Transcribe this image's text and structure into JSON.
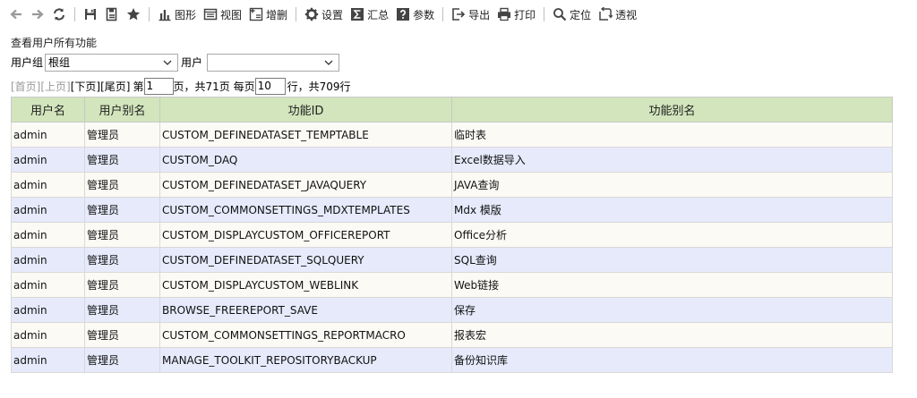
{
  "toolbar": {
    "buttons": [
      {
        "name": "back-icon",
        "label": ""
      },
      {
        "name": "forward-icon",
        "label": ""
      },
      {
        "name": "refresh-icon",
        "label": ""
      },
      {
        "name": "save-icon",
        "label": ""
      },
      {
        "name": "save-as-icon",
        "label": ""
      },
      {
        "name": "favorite-icon",
        "label": ""
      },
      {
        "name": "chart-icon",
        "label": "图形"
      },
      {
        "name": "view-icon",
        "label": "视图"
      },
      {
        "name": "add-delete-icon",
        "label": "增删"
      },
      {
        "name": "settings-icon",
        "label": "设置"
      },
      {
        "name": "sum-icon",
        "label": "汇总"
      },
      {
        "name": "param-icon",
        "label": "参数"
      },
      {
        "name": "export-icon",
        "label": "导出"
      },
      {
        "name": "print-icon",
        "label": "打印"
      },
      {
        "name": "locate-icon",
        "label": "定位"
      },
      {
        "name": "pivot-icon",
        "label": "透视"
      }
    ]
  },
  "caption": "查看用户所有功能",
  "filter": {
    "group_label": "用户组",
    "group_value": "根组",
    "user_label": "用户",
    "user_value": ""
  },
  "pager": {
    "first": "[首页]",
    "prev": "[上页]",
    "next": "[下页]",
    "last": "[尾页]",
    "page_prefix": "第",
    "page_value": "1",
    "page_suffix": "页，共71页 每页",
    "size_value": "10",
    "size_suffix": "行，共709行"
  },
  "table": {
    "headers": [
      "用户名",
      "用户别名",
      "功能ID",
      "功能别名"
    ],
    "rows": [
      [
        "admin",
        "管理员",
        "CUSTOM_DEFINEDATASET_TEMPTABLE",
        "临时表"
      ],
      [
        "admin",
        "管理员",
        "CUSTOM_DAQ",
        "Excel数据导入"
      ],
      [
        "admin",
        "管理员",
        "CUSTOM_DEFINEDATASET_JAVAQUERY",
        "JAVA查询"
      ],
      [
        "admin",
        "管理员",
        "CUSTOM_COMMONSETTINGS_MDXTEMPLATES",
        "Mdx 模版"
      ],
      [
        "admin",
        "管理员",
        "CUSTOM_DISPLAYCUSTOM_OFFICEREPORT",
        "Office分析"
      ],
      [
        "admin",
        "管理员",
        "CUSTOM_DEFINEDATASET_SQLQUERY",
        "SQL查询"
      ],
      [
        "admin",
        "管理员",
        "CUSTOM_DISPLAYCUSTOM_WEBLINK",
        "Web链接"
      ],
      [
        "admin",
        "管理员",
        "BROWSE_FREEREPORT_SAVE",
        "保存"
      ],
      [
        "admin",
        "管理员",
        "CUSTOM_COMMONSETTINGS_REPORTMACRO",
        "报表宏"
      ],
      [
        "admin",
        "管理员",
        "MANAGE_TOOLKIT_REPOSITORYBACKUP",
        "备份知识库"
      ]
    ]
  }
}
